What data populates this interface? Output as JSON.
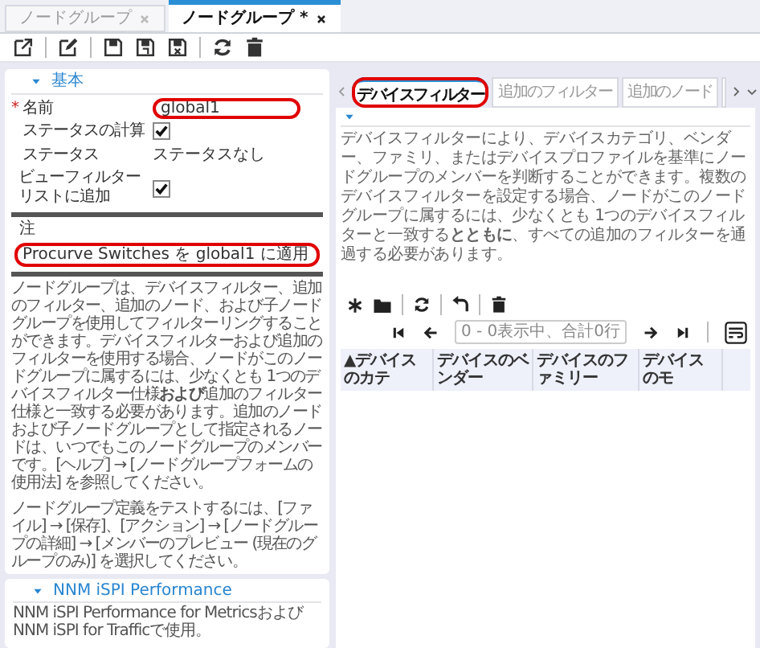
{
  "doc_tabs": [
    {
      "label": "ノードグループ",
      "selected": false
    },
    {
      "label": "ノードグループ *",
      "selected": true
    }
  ],
  "basic_section": {
    "title": "基本",
    "expanded": true,
    "fields": [
      {
        "kind": "text",
        "label": "名前",
        "required_mark": "*",
        "value": "global1",
        "highlighted": true
      },
      {
        "kind": "checkbox",
        "label": "ステータスの計算",
        "checked": true
      },
      {
        "kind": "static",
        "label": "ステータス",
        "value": "ステータスなし"
      },
      {
        "kind": "checkbox",
        "label": "ビューフィルターリストに追加",
        "checked": true
      }
    ],
    "note": {
      "label": "注",
      "value": "Procurve Switches を global1 に適用",
      "highlighted": true
    },
    "help_paragraphs": [
      "ノードグループは、デバイスフィルター、追加のフィルター、追加のノード、および子ノードグループを使用してフィルターリングすることができます。デバイスフィルターおよび追加のフィルターを使用する場合、ノードがこのノードグループに属するには、少なくとも 1つのデバイスフィルター仕様**および**追加のフィルター仕様と一致する必要があります。追加のノードおよび子ノードグループとして指定されるノードは、いつでもこのノードグループのメンバーです。[ヘルプ] → [ノードグループフォームの使用法] を参照してください。",
      "ノードグループ定義をテストするには、[ファイル] → [保存]、[アクション] → [ノードグループの詳細] → [メンバーのプレビュー (現在のグループのみ)] を選択してください。"
    ]
  },
  "nnm_section": {
    "title": "NNM iSPI Performance",
    "expanded": true,
    "text": "NNM iSPI Performance for MetricsおよびNNM iSPI for Trafficで使用。"
  },
  "filter_tabs": [
    {
      "label": "デバイスフィルター",
      "selected": true,
      "highlighted": true
    },
    {
      "label": "追加のフィルター",
      "selected": false,
      "highlighted": false
    },
    {
      "label": "追加のノード",
      "selected": false,
      "highlighted": false
    }
  ],
  "filter_panel": {
    "expanded": true,
    "description": "デバイスフィルターにより、デバイスカテゴリ、ベンダー、ファミリ、またはデバイスプロファイルを基準にノードグループのメンバーを判断することができます。複数のデバイスフィルターを設定する場合、ノードがこのノードグループに属するには、少なくとも 1つのデバイスフィルターと一致する**とともに**、すべての追加のフィルターを通過する必要があります。",
    "pager": {
      "status": "0 - 0表示中、合計0行"
    },
    "table": {
      "columns": [
        "▲デバイスのカテ",
        "デバイスのベンダー",
        "デバイスのファミリー",
        "デバイスのモ"
      ]
    }
  }
}
